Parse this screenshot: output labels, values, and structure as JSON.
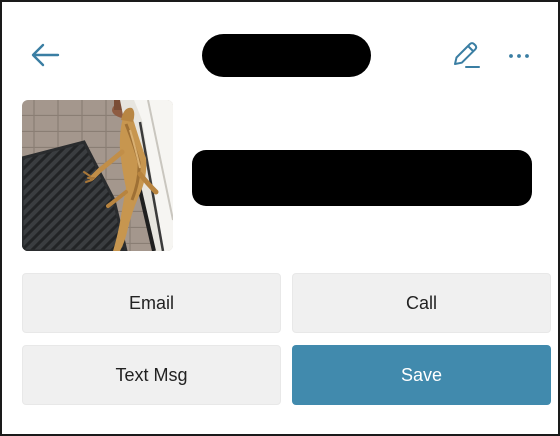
{
  "header": {
    "back_icon": "arrow-left-icon",
    "edit_icon": "pencil-icon",
    "more_icon": "more-horizontal-icon",
    "icon_color": "#3a7ea3"
  },
  "contact": {
    "photo": "lizard-photo"
  },
  "actions": {
    "email_label": "Email",
    "call_label": "Call",
    "text_label": "Text Msg",
    "save_label": "Save",
    "save_color": "#418aad"
  }
}
